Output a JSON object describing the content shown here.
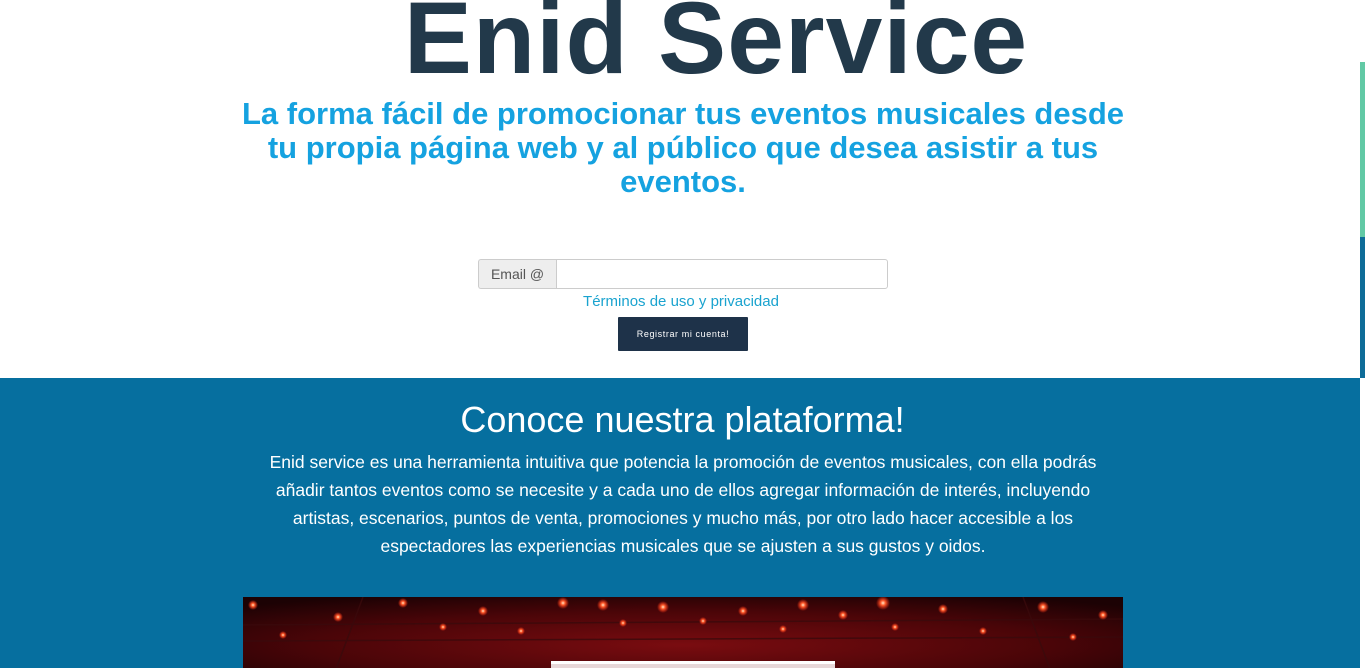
{
  "hero": {
    "title": "Enid Service",
    "tagline": "La forma fácil de promocionar tus eventos musicales desde tu propia página web y al público que desea asistir a tus eventos."
  },
  "signup": {
    "email_label": "Email @",
    "email_value": "",
    "email_placeholder": "",
    "terms_link": "Términos de uso y privacidad",
    "register_button": "Registrar mi cuenta!"
  },
  "platform": {
    "title": "Conoce nuestra plataforma!",
    "description": "Enid service es una herramienta intuitiva que potencia la promoción de eventos musicales, con ella podrás añadir tantos eventos como se necesite y a cada uno de ellos agregar información de interés, incluyendo artistas, escenarios, puntos de venta, promociones y mucho más, por otro lado hacer accesible a los espectadores las experiencias musicales que se ajusten a sus gustos y oidos."
  },
  "colors": {
    "title": "#22394a",
    "tagline": "#15a2e0",
    "button": "#1e3249",
    "link": "#1aa3cf",
    "section_bg": "#066f9f",
    "scroll_accent": "#62c9a5"
  },
  "icons": {
    "concert_image": "concert-stage-photo"
  }
}
